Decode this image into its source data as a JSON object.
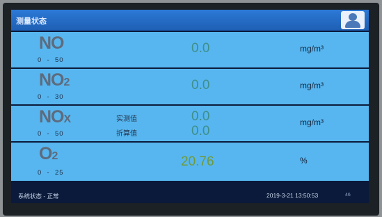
{
  "header": {
    "title": "测量状态",
    "user_icon": "user-icon"
  },
  "rows": [
    {
      "gas": "NO",
      "sub": "",
      "range": "0  -  50",
      "value": "0.0",
      "unit": "mg/m³"
    },
    {
      "gas": "NO",
      "sub": "2",
      "range": "0  -  30",
      "value": "0.0",
      "unit": "mg/m³"
    },
    {
      "gas": "NO",
      "sub": "X",
      "range": "0  -  50",
      "measured_label": "实测值",
      "measured_value": "0.0",
      "converted_label": "折算值",
      "converted_value": "0.0",
      "unit": "mg/m³"
    },
    {
      "gas": "O",
      "sub": "2",
      "range": "0  -  25",
      "value": "20.76",
      "unit": "%"
    }
  ],
  "footer": {
    "status": "系统状态 - 正常",
    "datetime": "2019-3-21 13:50:53",
    "code": "46"
  },
  "colors": {
    "row_bg": "#57b6ef",
    "value_text": "#3e8f8c",
    "o2_value": "#6f9a3a",
    "titlebar": "#2c79d6",
    "background": "#0b1a3a"
  }
}
